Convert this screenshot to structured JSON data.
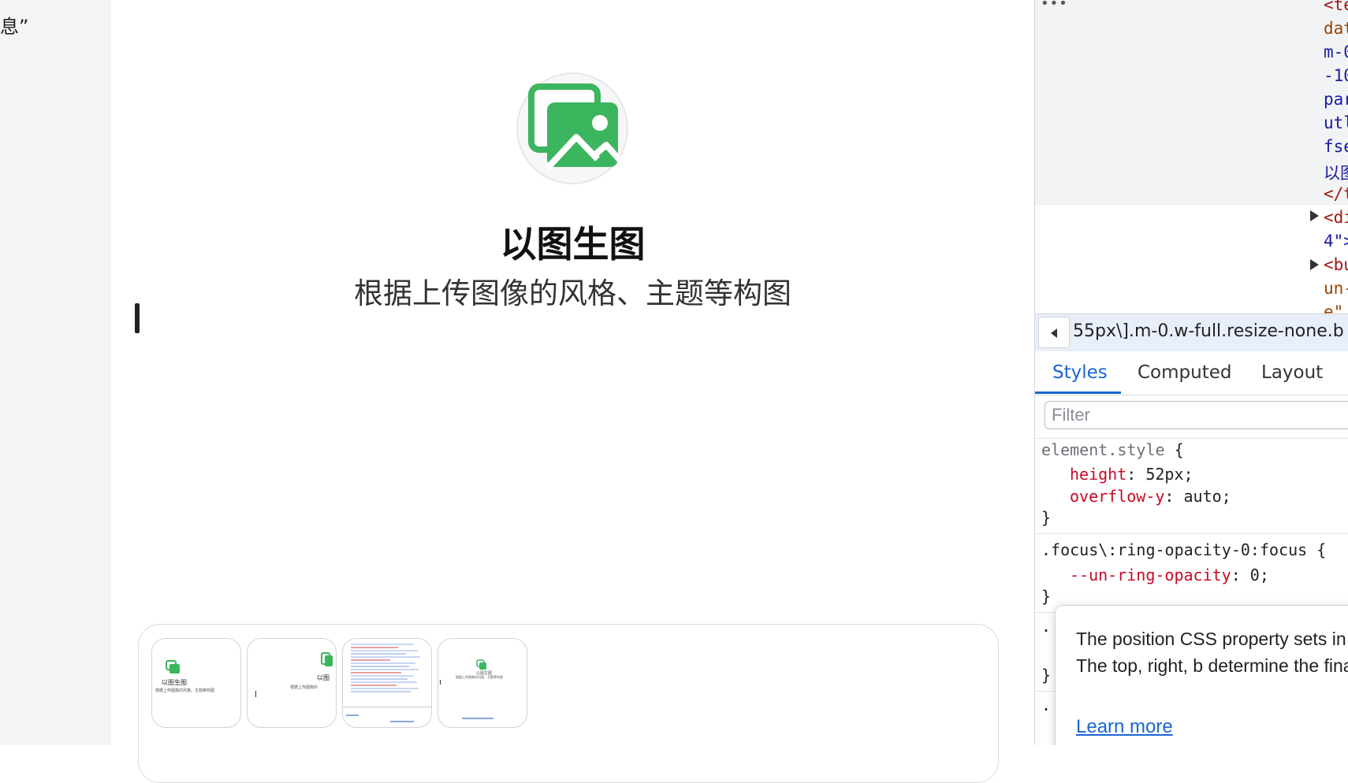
{
  "left_strip": {
    "snippet": "息”"
  },
  "hero": {
    "title": "以图生图",
    "subtitle": "根据上传图像的风格、主题等构图",
    "logo_icon": "image-stack-icon",
    "accent": "#3bb55e"
  },
  "thumbnails": [
    {
      "title": "以图生图",
      "sub": "根据上传图像的风格、主题等构图"
    },
    {
      "title": "以图",
      "sub": "根据上传图像的"
    },
    {
      "title": "",
      "sub": ""
    },
    {
      "title": "以图生图",
      "sub": "根据上传图像的风格、主题等构图"
    }
  ],
  "devtools": {
    "dom_lines": [
      {
        "text": "<te",
        "color": "#a31515"
      },
      {
        "text": "dat",
        "color": "#994500"
      },
      {
        "text": "m-0",
        "color": "#1a1aa6"
      },
      {
        "text": "-10",
        "color": "#1a1aa6"
      },
      {
        "text": "par",
        "color": "#1a1aa6"
      },
      {
        "text": "utl",
        "color": "#1a1aa6"
      },
      {
        "text": "fse",
        "color": "#1a1aa6"
      },
      {
        "text": "以图",
        "color": "#1a1aa6"
      },
      {
        "text": "</t",
        "color": "#a31515"
      },
      {
        "text": "<di",
        "color": "#a31515"
      },
      {
        "text": "4\">",
        "color": "#1a1aa6"
      },
      {
        "text": "<bu",
        "color": "#a31515"
      },
      {
        "text": "un-",
        "color": "#994500"
      },
      {
        "text": "e\"",
        "color": "#994500"
      }
    ],
    "breadcrumb": "55px\\].m-0.w-full.resize-none.b",
    "tabs": [
      "Styles",
      "Computed",
      "Layout"
    ],
    "filter_placeholder": "Filter",
    "rules": {
      "r1_selector": "element.style",
      "r1_brace": " {",
      "r1_p1_name": "height",
      "r1_p1_value": ": 52px;",
      "r1_p2_name": "overflow-y",
      "r1_p2_value": ": auto;",
      "close": "}",
      "r2_selector": ".focus\\:ring-opacity-0:focus {",
      "r2_p1_name": "--un-ring-opacity",
      "r2_p1_value": ": 0;",
      "partial_1": ".",
      "partial_2": "}",
      "partial_3": "."
    },
    "tooltip": {
      "text": "The position CSS property sets in a document. The top, right, b determine the final location of",
      "link": "Learn more"
    },
    "colors": {
      "active_tab": "#1a66d2",
      "property": "#c80a24"
    }
  }
}
